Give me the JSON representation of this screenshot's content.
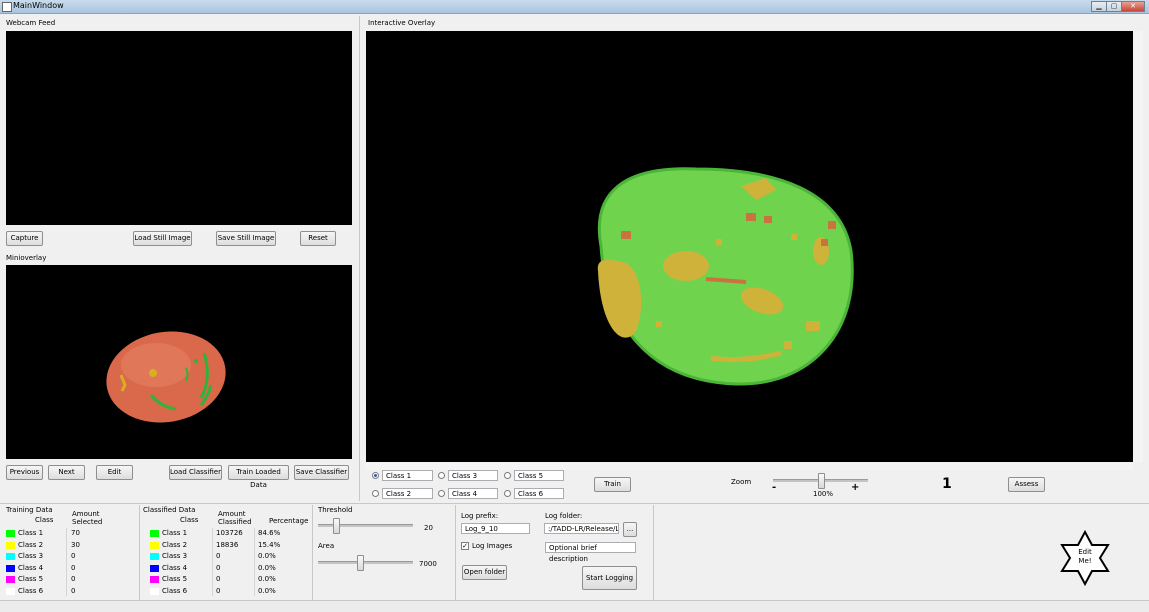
{
  "window": {
    "title": "MainWindow",
    "min": "▁",
    "max": "▢",
    "close": "✕"
  },
  "webcam": {
    "title": "Webcam Feed",
    "buttons": {
      "capture": "Capture",
      "load_still": "Load Still Image",
      "save_still": "Save Still Image",
      "reset": "Reset"
    }
  },
  "mini": {
    "title": "Minioverlay",
    "buttons": {
      "previous": "Previous",
      "next": "Next",
      "edit": "Edit",
      "load_classifier": "Load Classifier",
      "train_loaded": "Train Loaded Data",
      "save_classifier": "Save Classifier"
    }
  },
  "overlay": {
    "title": "Interactive Overlay"
  },
  "classes": {
    "selected": "Class 1",
    "items": [
      "Class 1",
      "Class 2",
      "Class 3",
      "Class 4",
      "Class 5",
      "Class 6"
    ],
    "train": "Train"
  },
  "zoom": {
    "label": "Zoom",
    "minus": "-",
    "plus": "+",
    "value": "100%",
    "level": 0.5
  },
  "counter": "1",
  "assess": "Assess",
  "training": {
    "title": "Training Data",
    "headers": [
      "Class",
      "Amount Selected"
    ],
    "rows": [
      {
        "class": "Class 1",
        "color": "#00ff00",
        "amount": "70"
      },
      {
        "class": "Class 2",
        "color": "#ffff00",
        "amount": "30"
      },
      {
        "class": "Class 3",
        "color": "#00ffff",
        "amount": "0"
      },
      {
        "class": "Class 4",
        "color": "#0000ff",
        "amount": "0"
      },
      {
        "class": "Class 5",
        "color": "#ff00ff",
        "amount": "0"
      },
      {
        "class": "Class 6",
        "color": "#ffffff",
        "amount": "0"
      }
    ]
  },
  "classified": {
    "title": "Classified Data",
    "headers": [
      "Class",
      "Amount Classified",
      "Percentage"
    ],
    "rows": [
      {
        "class": "Class 1",
        "color": "#00ff00",
        "amount": "103726",
        "pct": "84.6%"
      },
      {
        "class": "Class 2",
        "color": "#ffff00",
        "amount": "18836",
        "pct": "15.4%"
      },
      {
        "class": "Class 3",
        "color": "#00ffff",
        "amount": "0",
        "pct": "0.0%"
      },
      {
        "class": "Class 4",
        "color": "#0000ff",
        "amount": "0",
        "pct": "0.0%"
      },
      {
        "class": "Class 5",
        "color": "#ff00ff",
        "amount": "0",
        "pct": "0.0%"
      },
      {
        "class": "Class 6",
        "color": "#ffffff",
        "amount": "0",
        "pct": "0.0%"
      }
    ]
  },
  "threshold": {
    "label": "Threshold",
    "value": "20"
  },
  "area": {
    "label": "Area",
    "value": "7000"
  },
  "logging": {
    "prefix_label": "Log prefix:",
    "prefix_value": "Log_9_10",
    "folder_label": "Log folder:",
    "folder_value": ":/TADD-LR/Release/Logs",
    "browse": "...",
    "log_images_label": "Log Images",
    "log_images_checked": true,
    "description_value": "Optional brief description",
    "open_folder": "Open folder",
    "start_logging": "Start Logging"
  },
  "edit_star": {
    "line1": "Edit",
    "line2": "Me!"
  }
}
